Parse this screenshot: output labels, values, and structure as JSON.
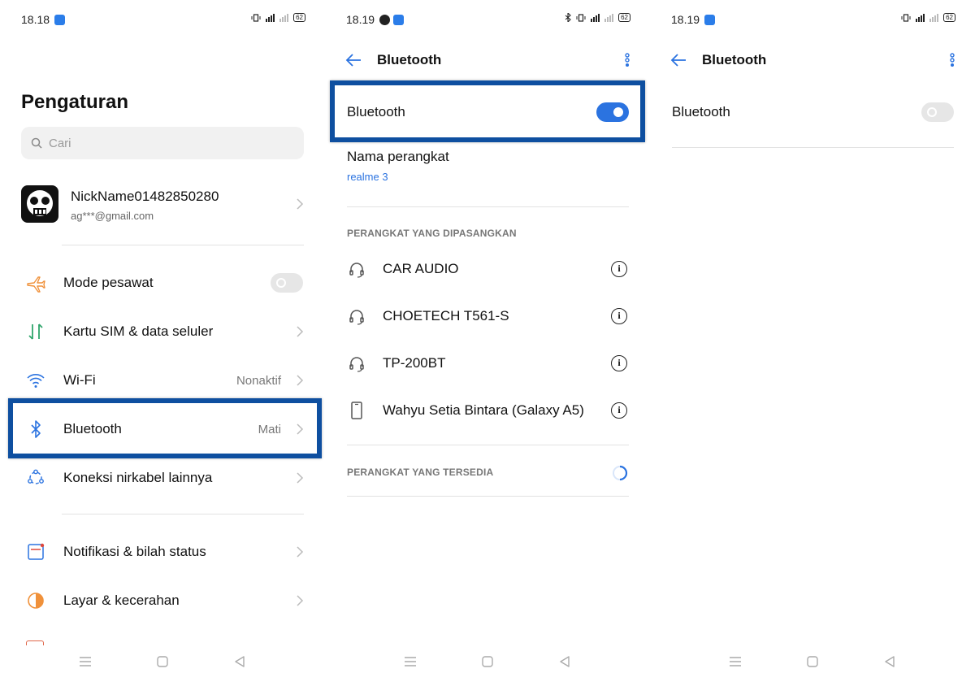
{
  "status_bar": [
    {
      "time": "18.18",
      "battery": "62"
    },
    {
      "time": "18.19",
      "battery": "62"
    },
    {
      "time": "18.19",
      "battery": "62"
    }
  ],
  "settings": {
    "title": "Pengaturan",
    "search_placeholder": "Cari",
    "account": {
      "name": "NickName01482850280",
      "email": "ag***@gmail.com"
    },
    "items": [
      {
        "label": "Mode pesawat",
        "value": "",
        "icon": "airplane-icon"
      },
      {
        "label": "Kartu SIM & data seluler",
        "value": "",
        "icon": "sim-data-icon"
      },
      {
        "label": "Wi-Fi",
        "value": "Nonaktif",
        "icon": "wifi-icon"
      },
      {
        "label": "Bluetooth",
        "value": "Mati",
        "icon": "bluetooth-icon"
      },
      {
        "label": "Koneksi nirkabel lainnya",
        "value": "",
        "icon": "connections-icon"
      },
      {
        "label": "Notifikasi & bilah status",
        "value": "",
        "icon": "notification-icon"
      },
      {
        "label": "Layar & kecerahan",
        "value": "",
        "icon": "display-icon"
      }
    ],
    "airplane_mode_on": false
  },
  "bluetooth_on_screen": {
    "title": "Bluetooth",
    "toggle_label": "Bluetooth",
    "toggle_on": true,
    "device_name_label": "Nama perangkat",
    "device_name_value": "realme 3",
    "paired_header": "PERANGKAT YANG DIPASANGKAN",
    "paired_devices": [
      {
        "name": "CAR AUDIO",
        "icon": "headset-icon"
      },
      {
        "name": "CHOETECH T561-S",
        "icon": "headset-icon"
      },
      {
        "name": "TP-200BT",
        "icon": "headset-icon"
      },
      {
        "name": "Wahyu Setia Bintara (Galaxy A5)",
        "icon": "phone-icon"
      }
    ],
    "available_header": "PERANGKAT YANG TERSEDIA"
  },
  "bluetooth_off_screen": {
    "title": "Bluetooth",
    "toggle_label": "Bluetooth",
    "toggle_on": false
  },
  "colors": {
    "accent": "#2b73e0",
    "highlight_border": "#0e4fa0"
  }
}
